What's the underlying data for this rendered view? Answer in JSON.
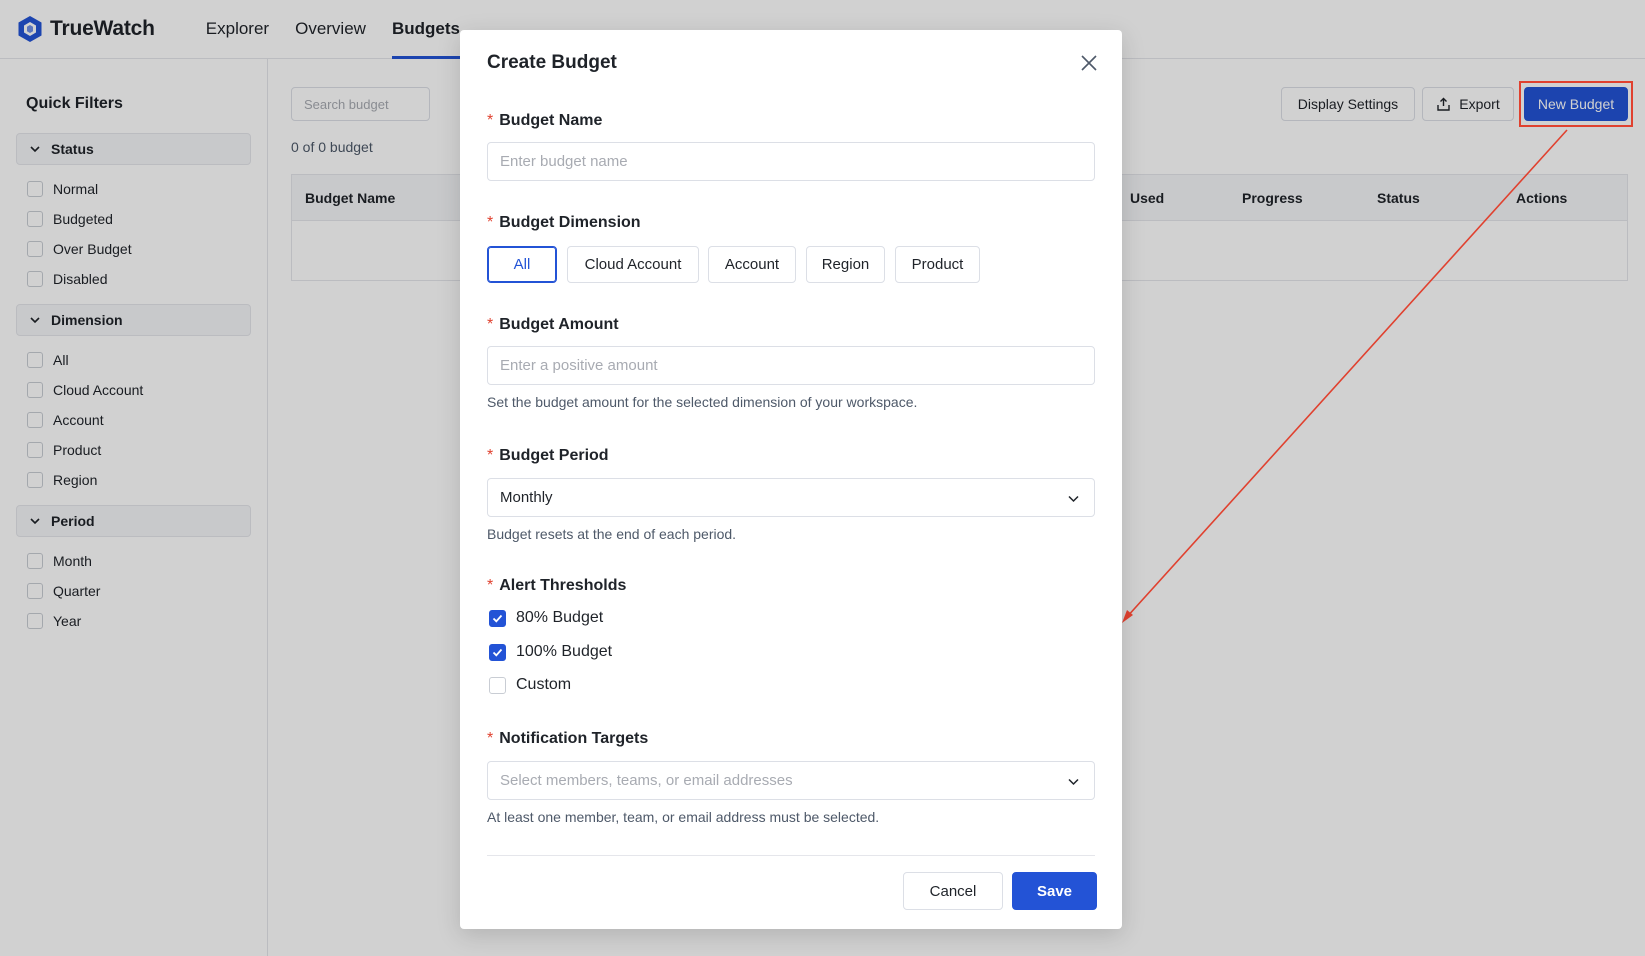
{
  "app": {
    "name": "TrueWatch"
  },
  "nav": {
    "items": [
      {
        "label": "Explorer"
      },
      {
        "label": "Overview"
      },
      {
        "label": "Budgets"
      }
    ]
  },
  "sidebar": {
    "title": "Quick Filters",
    "groups": [
      {
        "label": "Status",
        "items": [
          "Normal",
          "Budgeted",
          "Over Budget",
          "Disabled"
        ]
      },
      {
        "label": "Dimension",
        "items": [
          "All",
          "Cloud Account",
          "Account",
          "Product",
          "Region"
        ]
      },
      {
        "label": "Period",
        "items": [
          "Month",
          "Quarter",
          "Year"
        ]
      }
    ]
  },
  "main": {
    "search_placeholder": "Search budget",
    "count_text": "0 of 0 budget",
    "display_settings_label": "Display Settings",
    "export_label": "Export",
    "new_budget_label": "New Budget",
    "columns": [
      "Budget Name",
      "Used",
      "Progress",
      "Status",
      "Actions"
    ]
  },
  "modal": {
    "title": "Create Budget",
    "name_label": "Budget Name",
    "name_placeholder": "Enter budget name",
    "dimension_label": "Budget Dimension",
    "dimension_options": [
      "All",
      "Cloud Account",
      "Account",
      "Region",
      "Product"
    ],
    "dimension_selected": "All",
    "amount_label": "Budget Amount",
    "amount_placeholder": "Enter a positive amount",
    "amount_help": "Set the budget amount for the selected dimension of your workspace.",
    "period_label": "Budget Period",
    "period_value": "Monthly",
    "period_help": "Budget resets at the end of each period.",
    "alert_label": "Alert Thresholds",
    "alerts": [
      {
        "label": "80% Budget",
        "checked": true
      },
      {
        "label": "100% Budget",
        "checked": true
      },
      {
        "label": "Custom",
        "checked": false
      }
    ],
    "notify_label": "Notification Targets",
    "notify_placeholder": "Select members, teams, or email addresses",
    "notify_help": "At least one member, team, or email address must be selected.",
    "cancel_label": "Cancel",
    "save_label": "Save"
  },
  "colors": {
    "accent": "#2353d6",
    "required": "#e0412f",
    "annotation": "#e0412f"
  }
}
